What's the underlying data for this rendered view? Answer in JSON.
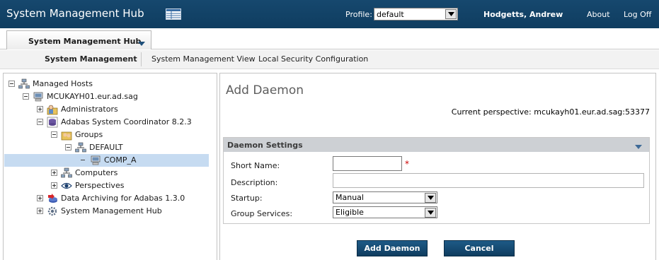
{
  "header": {
    "title": "System Management Hub",
    "grid_icon": "table-grid-icon",
    "profile_label": "Profile:",
    "profile_value": "default",
    "user_name": "Hodgetts, Andrew",
    "about_label": "About",
    "logoff_label": "Log Off"
  },
  "tab": {
    "label": "System Management Hub",
    "arrow_icon": "triangle-down-icon"
  },
  "subnav": {
    "items": [
      "System Management",
      "System Management View",
      "Local Security Configuration"
    ],
    "active": "System Management"
  },
  "tree": {
    "items": [
      {
        "label": "Managed Hosts",
        "icon": "network-hosts-icon",
        "expander": "minus",
        "selected": false
      },
      {
        "label": "MCUKAYH01.eur.ad.sag",
        "icon": "computer-icon",
        "expander": "minus",
        "selected": false
      },
      {
        "label": "Administrators",
        "icon": "administrators-icon",
        "expander": "plus",
        "selected": false
      },
      {
        "label": "Adabas System Coordinator 8.2.3",
        "icon": "database-icon",
        "expander": "minus",
        "selected": false
      },
      {
        "label": "Groups",
        "icon": "groups-icon",
        "expander": "minus",
        "selected": false
      },
      {
        "label": "DEFAULT",
        "icon": "network-hosts-icon",
        "expander": "minus",
        "selected": false
      },
      {
        "label": "COMP_A",
        "icon": "computer-icon",
        "expander": "dash",
        "selected": true
      },
      {
        "label": "Computers",
        "icon": "network-hosts-icon",
        "expander": "plus",
        "selected": false
      },
      {
        "label": "Perspectives",
        "icon": "eye-icon",
        "expander": "plus",
        "selected": false
      },
      {
        "label": "Data Archiving for Adabas 1.3.0",
        "icon": "archive-icon",
        "expander": "plus",
        "selected": false
      },
      {
        "label": "System Management Hub",
        "icon": "hub-gear-icon",
        "expander": "plus",
        "selected": false
      }
    ]
  },
  "content": {
    "heading": "Add Daemon",
    "perspective_text": "Current perspective: mcukayh01.eur.ad.sag:53377",
    "section_title": "Daemon Settings",
    "fields": {
      "short_name_label": "Short Name:",
      "short_name_value": "",
      "required_marker": "*",
      "description_label": "Description:",
      "description_value": "",
      "startup_label": "Startup:",
      "startup_value": "Manual",
      "group_services_label": "Group Services:",
      "group_services_value": "Eligible"
    },
    "buttons": {
      "add": "Add Daemon",
      "cancel": "Cancel"
    }
  },
  "colors": {
    "header_bg": "#123f63",
    "selected_row": "#c6dbf1",
    "section_header": "#cdd0d4",
    "button_bg": "#174d75",
    "required": "#cc0000"
  }
}
